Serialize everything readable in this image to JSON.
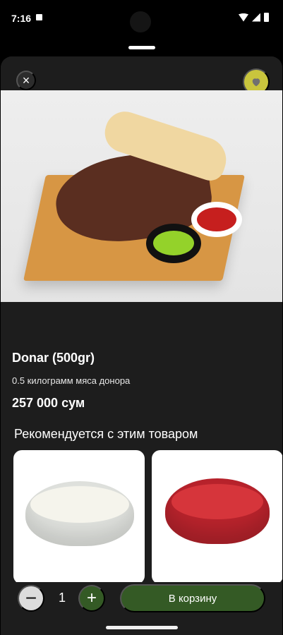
{
  "status_bar": {
    "time": "7:16"
  },
  "product": {
    "title": "Donar (500gr)",
    "description": "0.5 килограмм мяса донора",
    "price": "257 000 сум"
  },
  "recommendations": {
    "heading": "Рекомендуется с этим товаром"
  },
  "actions": {
    "close_icon": "×",
    "minus_label": "−",
    "quantity": "1",
    "plus_label": "+",
    "cart_label": "В корзину"
  },
  "icons": {
    "close": "close-icon",
    "favorite": "heart-icon"
  },
  "colors": {
    "background": "#1d1d1d",
    "favorite": "#c9c53d",
    "primary": "#345a25",
    "minus": "#dcdcdc"
  }
}
